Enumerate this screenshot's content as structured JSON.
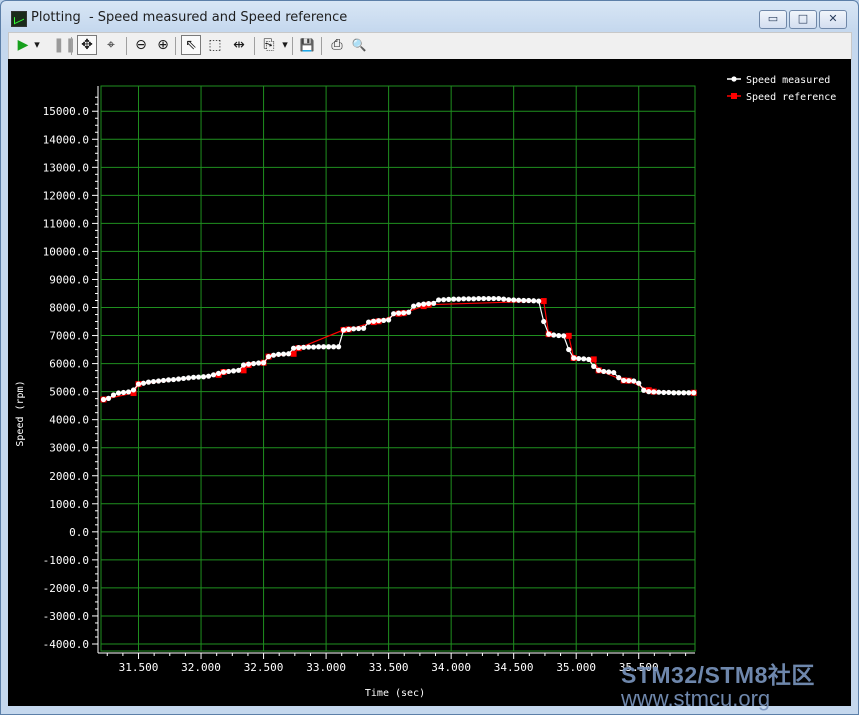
{
  "window": {
    "title": "Plotting  - Speed measured and Speed reference",
    "minimize_label": "▭",
    "maximize_label": "□",
    "close_label": "✕"
  },
  "toolbar": [
    {
      "name": "play-icon",
      "glyph": "▶",
      "color": "#16a01c"
    },
    {
      "name": "play-dropdown-icon",
      "glyph": "▾",
      "color": "#1a1a1a"
    },
    {
      "name": "pause-icon",
      "glyph": "❚❚",
      "color": "#9a9a9a"
    },
    {
      "name": "pan-icon",
      "glyph": "✥",
      "color": "#1a1a1a",
      "active": true
    },
    {
      "name": "zoom-extents-icon",
      "glyph": "⌖",
      "color": "#1a1a1a"
    },
    {
      "name": "zoom-out-icon",
      "glyph": "⊖",
      "color": "#1a1a1a"
    },
    {
      "name": "zoom-in-icon",
      "glyph": "⊕",
      "color": "#1a1a1a"
    },
    {
      "name": "select-pointer-icon",
      "glyph": "⇖",
      "color": "#1a1a1a",
      "active": true
    },
    {
      "name": "select-rect-icon",
      "glyph": "⬚",
      "color": "#1a1a1a"
    },
    {
      "name": "cursor-icon",
      "glyph": "⇹",
      "color": "#1a1a1a"
    },
    {
      "name": "copy-icon",
      "glyph": "⎘",
      "color": "#1a1a1a"
    },
    {
      "name": "copy-dropdown-icon",
      "glyph": "▾",
      "color": "#1a1a1a"
    },
    {
      "name": "save-icon",
      "glyph": "💾",
      "color": "#1a1a1a"
    },
    {
      "name": "print-icon",
      "glyph": "⎙",
      "color": "#1a1a1a"
    },
    {
      "name": "print-preview-icon",
      "glyph": "🔍",
      "color": "#1a1a1a"
    }
  ],
  "watermark": {
    "line1": "STM32/STM8社区",
    "line2": "www.stmcu.org"
  },
  "chart_data": {
    "type": "line",
    "xlabel": "Time (sec)",
    "ylabel": "Speed (rpm)",
    "xlim": [
      31.2,
      35.95
    ],
    "ylim": [
      -4250,
      15900
    ],
    "x_ticks": [
      31.5,
      32.0,
      32.5,
      33.0,
      33.5,
      34.0,
      34.5,
      35.0,
      35.5
    ],
    "x_tick_labels": [
      "31.500",
      "32.000",
      "32.500",
      "33.000",
      "33.500",
      "34.000",
      "34.500",
      "35.000",
      "35.500"
    ],
    "y_ticks": [
      -4000,
      -3000,
      -2000,
      -1000,
      0,
      1000,
      2000,
      3000,
      4000,
      5000,
      6000,
      7000,
      8000,
      9000,
      10000,
      11000,
      12000,
      13000,
      14000,
      15000
    ],
    "y_tick_labels": [
      "-4000.0",
      "-3000.0",
      "-2000.0",
      "-1000.0",
      "0.0",
      "1000.0",
      "2000.0",
      "3000.0",
      "4000.0",
      "5000.0",
      "6000.0",
      "7000.0",
      "8000.0",
      "9000.0",
      "10000.0",
      "11000.0",
      "12000.0",
      "13000.0",
      "14000.0",
      "15000.0"
    ],
    "grid": true,
    "grid_color": "#1f8f1f",
    "background": "#000000",
    "legend_position": "right",
    "series": [
      {
        "name": "Speed measured",
        "color": "#ffffff",
        "marker": "circle",
        "x": [
          31.22,
          31.26,
          31.3,
          31.34,
          31.38,
          31.42,
          31.46,
          31.5,
          31.54,
          31.58,
          31.62,
          31.66,
          31.7,
          31.74,
          31.78,
          31.82,
          31.86,
          31.9,
          31.94,
          31.98,
          32.02,
          32.06,
          32.1,
          32.14,
          32.18,
          32.22,
          32.26,
          32.3,
          32.34,
          32.38,
          32.42,
          32.46,
          32.5,
          32.54,
          32.58,
          32.62,
          32.66,
          32.7,
          32.74,
          32.78,
          32.82,
          32.86,
          32.9,
          32.94,
          32.98,
          33.02,
          33.06,
          33.1,
          33.14,
          33.18,
          33.22,
          33.26,
          33.3,
          33.34,
          33.38,
          33.42,
          33.46,
          33.5,
          33.54,
          33.58,
          33.62,
          33.66,
          33.7,
          33.74,
          33.78,
          33.82,
          33.86,
          33.9,
          33.94,
          33.98,
          34.02,
          34.06,
          34.1,
          34.14,
          34.18,
          34.22,
          34.26,
          34.3,
          34.34,
          34.38,
          34.42,
          34.46,
          34.5,
          34.54,
          34.58,
          34.62,
          34.66,
          34.7,
          34.74,
          34.78,
          34.82,
          34.86,
          34.9,
          34.94,
          34.98,
          35.02,
          35.06,
          35.1,
          35.14,
          35.18,
          35.22,
          35.26,
          35.3,
          35.34,
          35.38,
          35.42,
          35.46,
          35.5,
          35.54,
          35.58,
          35.62,
          35.66,
          35.7,
          35.74,
          35.78,
          35.82,
          35.86,
          35.9,
          35.94
        ],
        "y": [
          4720,
          4760,
          4880,
          4950,
          4970,
          4990,
          5060,
          5270,
          5300,
          5340,
          5360,
          5380,
          5400,
          5420,
          5430,
          5450,
          5470,
          5490,
          5510,
          5520,
          5530,
          5550,
          5600,
          5650,
          5700,
          5720,
          5740,
          5760,
          5950,
          5980,
          6000,
          6020,
          6030,
          6250,
          6300,
          6330,
          6340,
          6350,
          6550,
          6570,
          6580,
          6590,
          6590,
          6600,
          6600,
          6600,
          6600,
          6600,
          7200,
          7220,
          7240,
          7250,
          7260,
          7480,
          7510,
          7530,
          7540,
          7560,
          7780,
          7800,
          7810,
          7830,
          8050,
          8100,
          8120,
          8140,
          8150,
          8270,
          8280,
          8290,
          8300,
          8300,
          8310,
          8310,
          8310,
          8320,
          8320,
          8320,
          8320,
          8320,
          8300,
          8280,
          8270,
          8260,
          8250,
          8250,
          8240,
          8230,
          7500,
          7050,
          7020,
          7000,
          6990,
          6500,
          6200,
          6180,
          6170,
          6150,
          5900,
          5760,
          5720,
          5700,
          5680,
          5500,
          5400,
          5390,
          5380,
          5300,
          5050,
          5000,
          4990,
          4980,
          4970,
          4970,
          4960,
          4960,
          4960,
          4960,
          4960
        ]
      },
      {
        "name": "Speed reference",
        "color": "#ff0000",
        "marker": "square",
        "x": [
          31.22,
          31.46,
          31.5,
          32.14,
          32.18,
          32.34,
          32.38,
          32.5,
          32.54,
          32.74,
          32.78,
          33.14,
          33.18,
          33.38,
          33.42,
          33.58,
          33.62,
          33.78,
          33.82,
          34.74,
          34.78,
          34.94,
          34.98,
          35.14,
          35.18,
          35.38,
          35.42,
          35.58,
          35.62,
          35.94
        ],
        "y": [
          4720,
          4950,
          5270,
          5600,
          5700,
          5760,
          5950,
          6030,
          6250,
          6350,
          6550,
          7200,
          7220,
          7480,
          7510,
          7780,
          7800,
          8050,
          8100,
          8230,
          7050,
          6990,
          6200,
          6150,
          5760,
          5400,
          5390,
          5050,
          5000,
          4960
        ]
      }
    ]
  }
}
